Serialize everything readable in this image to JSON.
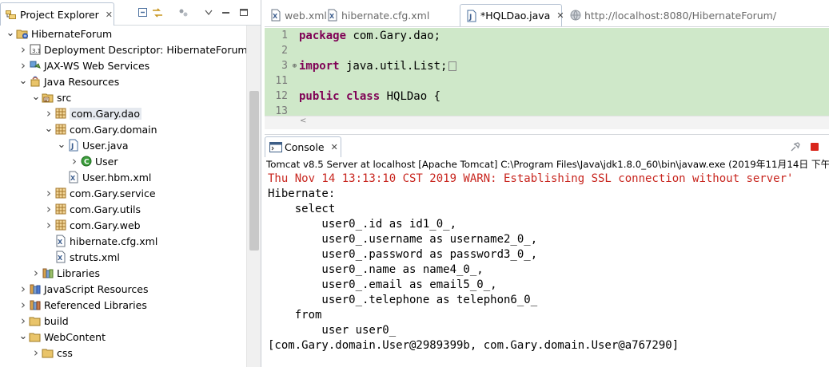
{
  "project_explorer": {
    "title": "Project Explorer",
    "tree": [
      {
        "label": "HibernateForum",
        "depth": 0,
        "arrow": "down",
        "icon": "project-icon"
      },
      {
        "label": "Deployment Descriptor: HibernateForum",
        "depth": 1,
        "arrow": "right",
        "icon": "deployment-descriptor-icon"
      },
      {
        "label": "JAX-WS Web Services",
        "depth": 1,
        "arrow": "right",
        "icon": "web-services-icon"
      },
      {
        "label": "Java Resources",
        "depth": 1,
        "arrow": "down",
        "icon": "java-resources-icon"
      },
      {
        "label": "src",
        "depth": 2,
        "arrow": "down",
        "icon": "source-folder-icon"
      },
      {
        "label": "com.Gary.dao",
        "depth": 3,
        "arrow": "right",
        "icon": "package-icon",
        "selected": true
      },
      {
        "label": "com.Gary.domain",
        "depth": 3,
        "arrow": "down",
        "icon": "package-icon"
      },
      {
        "label": "User.java",
        "depth": 4,
        "arrow": "down",
        "icon": "java-file-icon"
      },
      {
        "label": "User",
        "depth": 5,
        "arrow": "right",
        "icon": "class-icon"
      },
      {
        "label": "User.hbm.xml",
        "depth": 4,
        "arrow": "none",
        "icon": "xml-file-icon"
      },
      {
        "label": "com.Gary.service",
        "depth": 3,
        "arrow": "right",
        "icon": "package-icon"
      },
      {
        "label": "com.Gary.utils",
        "depth": 3,
        "arrow": "right",
        "icon": "package-icon"
      },
      {
        "label": "com.Gary.web",
        "depth": 3,
        "arrow": "right",
        "icon": "package-icon"
      },
      {
        "label": "hibernate.cfg.xml",
        "depth": 3,
        "arrow": "none",
        "icon": "xml-file-icon"
      },
      {
        "label": "struts.xml",
        "depth": 3,
        "arrow": "none",
        "icon": "xml-file-icon"
      },
      {
        "label": "Libraries",
        "depth": 2,
        "arrow": "right",
        "icon": "libraries-icon"
      },
      {
        "label": "JavaScript Resources",
        "depth": 1,
        "arrow": "right",
        "icon": "javascript-resources-icon"
      },
      {
        "label": "Referenced Libraries",
        "depth": 1,
        "arrow": "right",
        "icon": "referenced-libraries-icon"
      },
      {
        "label": "build",
        "depth": 1,
        "arrow": "right",
        "icon": "folder-icon"
      },
      {
        "label": "WebContent",
        "depth": 1,
        "arrow": "down",
        "icon": "folder-icon"
      },
      {
        "label": "css",
        "depth": 2,
        "arrow": "right",
        "icon": "folder-icon"
      }
    ]
  },
  "editor": {
    "tabs": [
      {
        "label": "web.xml",
        "active": false,
        "icon": "xml-file-icon"
      },
      {
        "label": "hibernate.cfg.xml",
        "active": false,
        "icon": "xml-file-icon"
      },
      {
        "label": "*HQLDao.java",
        "active": true,
        "icon": "java-file-icon"
      },
      {
        "label": "http://localhost:8080/HibernateForum/",
        "active": false,
        "icon": "globe-icon"
      }
    ],
    "lines": [
      {
        "num": "1",
        "fold": "",
        "kw": "package",
        "rest": " com.Gary.dao;"
      },
      {
        "num": "2",
        "fold": "",
        "kw": "",
        "rest": ""
      },
      {
        "num": "3",
        "fold": "⊕",
        "kw": "import",
        "rest": " java.util.List;",
        "collapsed": true
      },
      {
        "num": "11",
        "fold": "",
        "kw": "",
        "rest": ""
      },
      {
        "num": "12",
        "fold": "",
        "kw": "public class",
        "rest": " HQLDao {"
      },
      {
        "num": "13",
        "fold": "",
        "kw": "",
        "rest": ""
      }
    ]
  },
  "console": {
    "title": "Console",
    "description": "Tomcat v8.5 Server at localhost [Apache Tomcat] C:\\Program Files\\Java\\jdk1.8.0_60\\bin\\javaw.exe (2019年11月14日 下午1:",
    "output": [
      {
        "text": "Thu Nov 14 13:13:10 CST 2019 WARN: Establishing SSL connection without server'",
        "warn": true
      },
      {
        "text": "Hibernate: "
      },
      {
        "text": "    select"
      },
      {
        "text": "        user0_.id as id1_0_,"
      },
      {
        "text": "        user0_.username as username2_0_,"
      },
      {
        "text": "        user0_.password as password3_0_,"
      },
      {
        "text": "        user0_.name as name4_0_,"
      },
      {
        "text": "        user0_.email as email5_0_,"
      },
      {
        "text": "        user0_.telephone as telephon6_0_"
      },
      {
        "text": "    from"
      },
      {
        "text": "        user user0_"
      },
      {
        "text": "[com.Gary.domain.User@2989399b, com.Gary.domain.User@a767290]"
      }
    ]
  },
  "colors": {
    "editor_background": "#cfe8c9",
    "keyword": "#7f0055",
    "warning_text": "#c8261f",
    "selection": "#e5e9ef"
  }
}
